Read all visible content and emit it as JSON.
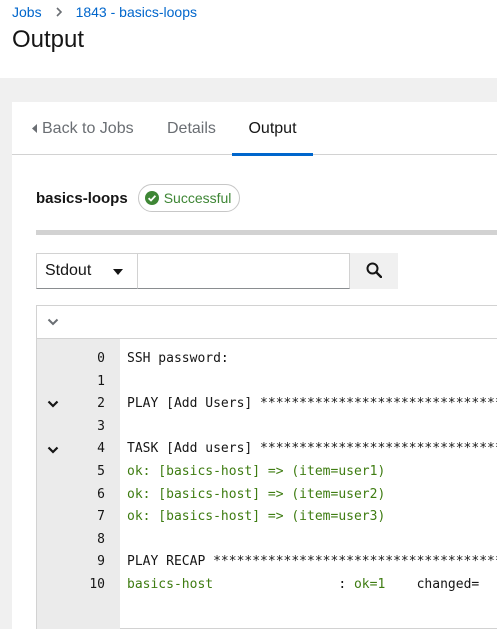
{
  "breadcrumb": {
    "jobs": "Jobs",
    "current": "1843 - basics-loops"
  },
  "page_title": "Output",
  "tabs": {
    "back": "Back to Jobs",
    "details": "Details",
    "output": "Output"
  },
  "job": {
    "name": "basics-loops",
    "status": "Successful"
  },
  "toolbar": {
    "stdout_label": "Stdout",
    "search_value": ""
  },
  "colors": {
    "link": "#0066cc",
    "success": "#3e8635",
    "ok_text": "#3e7c11",
    "gutter": "#ebebeb"
  },
  "output_lines": [
    {
      "num": "0",
      "text": "SSH password:",
      "collapsible": false,
      "ok": false
    },
    {
      "num": "1",
      "text": "",
      "collapsible": false,
      "ok": false
    },
    {
      "num": "2",
      "text": "PLAY [Add Users] ******************************************",
      "collapsible": true,
      "ok": false
    },
    {
      "num": "3",
      "text": "",
      "collapsible": false,
      "ok": false
    },
    {
      "num": "4",
      "text": "TASK [Add users] ******************************************",
      "collapsible": true,
      "ok": false
    },
    {
      "num": "5",
      "text": "ok: [basics-host] => (item=user1)",
      "collapsible": false,
      "ok": true
    },
    {
      "num": "6",
      "text": "ok: [basics-host] => (item=user2)",
      "collapsible": false,
      "ok": true
    },
    {
      "num": "7",
      "text": "ok: [basics-host] => (item=user3)",
      "collapsible": false,
      "ok": true
    },
    {
      "num": "8",
      "text": "",
      "collapsible": false,
      "ok": false
    },
    {
      "num": "9",
      "text": "PLAY RECAP ************************************************",
      "collapsible": false,
      "ok": false
    },
    {
      "num": "10",
      "text": "basics-host                : ok=1    changed=",
      "collapsible": false,
      "ok": false,
      "recap": true
    }
  ]
}
